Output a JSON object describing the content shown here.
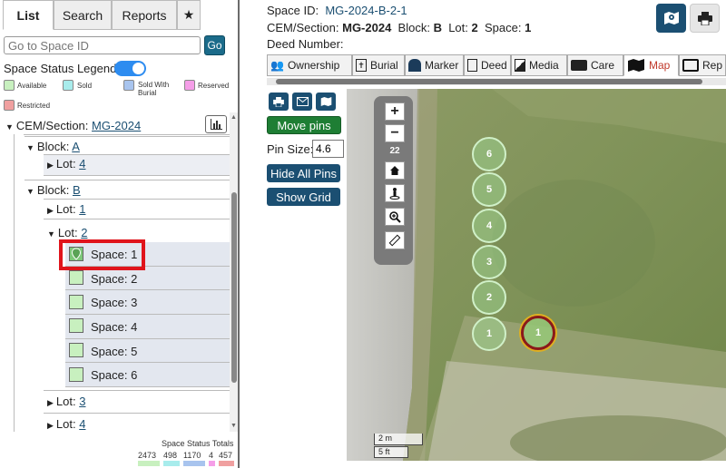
{
  "left": {
    "tabs": [
      "List",
      "Search",
      "Reports",
      "★"
    ],
    "search_placeholder": "Go to Space ID",
    "go_label": "Go",
    "legend_title": "Space Status Legend:",
    "legend": [
      {
        "label": "Available",
        "color": "#c8f0bf"
      },
      {
        "label": "Sold",
        "color": "#a8ecec"
      },
      {
        "label": "Sold With Burial",
        "color": "#a8c4ee"
      },
      {
        "label": "Reserved",
        "color": "#f59ee8"
      },
      {
        "label": "Restricted",
        "color": "#f0a0a0"
      }
    ],
    "tree": {
      "cem_label": "CEM/Section:",
      "cem_value": "MG-2024",
      "block_a_label": "Block:",
      "block_a": "A",
      "lot_a4_label": "Lot:",
      "lot_a4": "4",
      "block_b_label": "Block:",
      "block_b": "B",
      "lot_b1_label": "Lot:",
      "lot_b1": "1",
      "lot_b2_label": "Lot:",
      "lot_b2": "2",
      "spaces": [
        {
          "label": "Space:",
          "num": "1"
        },
        {
          "label": "Space:",
          "num": "2"
        },
        {
          "label": "Space:",
          "num": "3"
        },
        {
          "label": "Space:",
          "num": "4"
        },
        {
          "label": "Space:",
          "num": "5"
        },
        {
          "label": "Space:",
          "num": "6"
        }
      ],
      "lot_b3_label": "Lot:",
      "lot_b3": "3",
      "lot_b4_label": "Lot:",
      "lot_b4": "4"
    },
    "totals_title": "Space Status Totals",
    "totals": [
      {
        "value": "2473",
        "color": "#c8f0bf"
      },
      {
        "value": "498",
        "color": "#a8ecec"
      },
      {
        "value": "1170",
        "color": "#a8c4ee"
      },
      {
        "value": "4",
        "color": "#f59ee8"
      },
      {
        "value": "457",
        "color": "#f0a0a0"
      }
    ]
  },
  "right": {
    "space_id_label": "Space ID:",
    "space_id": "MG-2024-B-2-1",
    "cem_label": "CEM/Section:",
    "cem_value": "MG-2024",
    "block_label": "Block:",
    "block_value": "B",
    "lot_label": "Lot:",
    "lot_value": "2",
    "space_label": "Space:",
    "space_value": "1",
    "deed_label": "Deed Number:",
    "tabs": [
      "Ownership",
      "Burial",
      "Marker",
      "Deed",
      "Media",
      "Care",
      "Map",
      "Rep"
    ],
    "active_tab": "Map",
    "move_pins": "Move pins",
    "pin_size_label": "Pin Size:",
    "pin_size_value": "4.6",
    "hide_pins": "Hide All Pins",
    "show_grid": "Show Grid",
    "map": {
      "zoom_level": "22",
      "zoom_in": "+",
      "zoom_out": "−",
      "pins": [
        "6",
        "5",
        "4",
        "3",
        "2",
        "1"
      ],
      "selected_pin": "1",
      "scale_m": "2 m",
      "scale_ft": "5 ft"
    },
    "colors": {
      "primary": "#1b4f72",
      "green": "#1e7e34",
      "accent": "#c0392b"
    }
  }
}
